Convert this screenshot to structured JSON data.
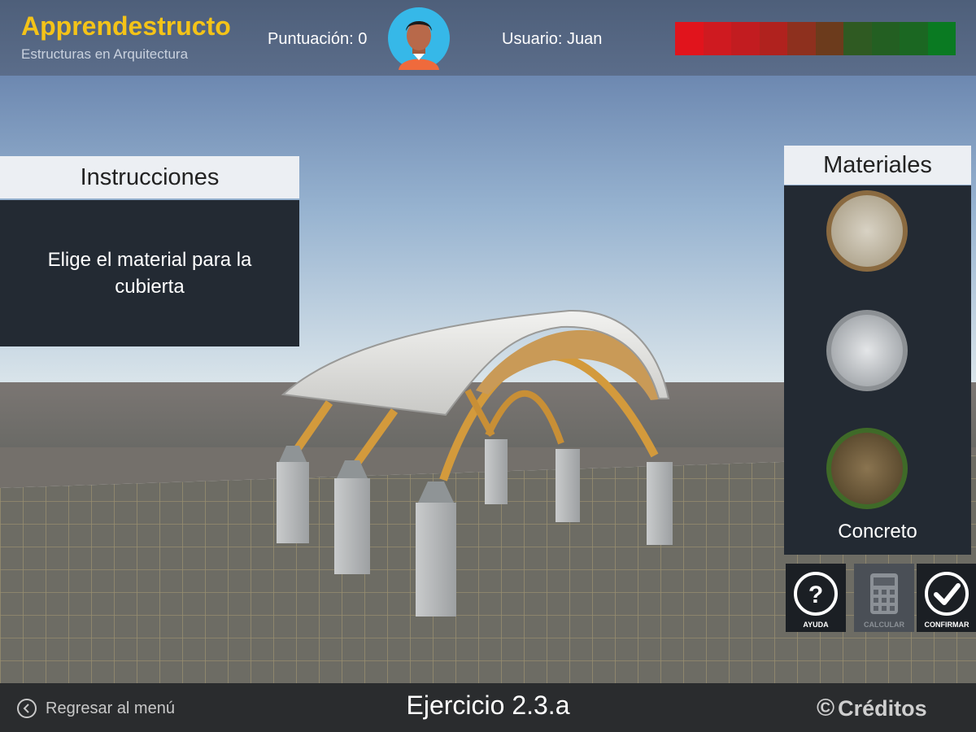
{
  "header": {
    "app_title": "Apprendestructo",
    "app_subtitle": "Estructuras en Arquitectura",
    "score_label": "Puntuación: 0",
    "user_label": "Usuario: Juan",
    "meter_colors": [
      "#e1141c",
      "#cf1a20",
      "#c21c20",
      "#b0221e",
      "#8e301e",
      "#6c3b1c",
      "#2f5a22",
      "#235f22",
      "#1b6722",
      "#0a7a22"
    ]
  },
  "instructions": {
    "title": "Instrucciones",
    "text": "Elige el material para la cubierta"
  },
  "materials": {
    "title": "Materiales",
    "selected_label": "Concreto",
    "options": [
      "stone-material-swatch",
      "concrete-material-swatch",
      "earth-material-swatch"
    ]
  },
  "actions": {
    "help_label": "AYUDA",
    "calc_label": "CALCULAR",
    "confirm_label": "CONFIRMAR"
  },
  "footer": {
    "back_label": "Regresar al menú",
    "exercise_label": "Ejercicio 2.3.a",
    "credits_label": "Créditos",
    "credits_symbol": "©"
  }
}
